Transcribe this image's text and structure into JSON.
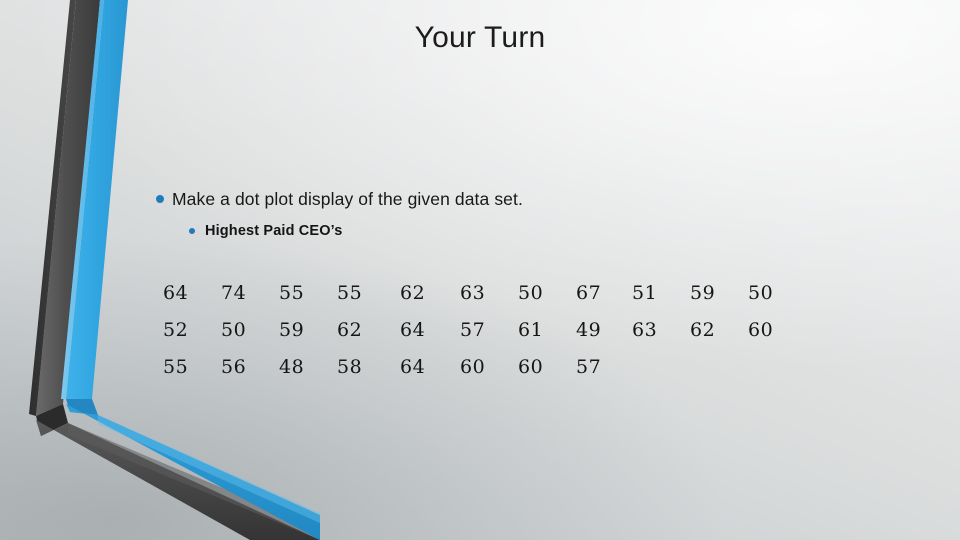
{
  "slide": {
    "title": "Your Turn",
    "accent_blue": "#35a8e0",
    "bullet_blue": "#1f7cb8",
    "band_gray": "#4d4d4d",
    "background_light": "#ecedee",
    "background_dark": "#c0c4c6"
  },
  "content": {
    "bullets": [
      {
        "level": 1,
        "text": "Make a dot plot display of the given data set."
      },
      {
        "level": 2,
        "text": "Highest Paid CEO’s"
      }
    ]
  },
  "chart_data": {
    "type": "table",
    "title": "Highest Paid CEO’s",
    "caption": "Make a dot plot display of the given data set.",
    "columns": 11,
    "rows": [
      [
        "64",
        "74",
        "55",
        "55",
        "62",
        "63",
        "50",
        "67",
        "51",
        "59",
        "50"
      ],
      [
        "52",
        "50",
        "59",
        "62",
        "64",
        "57",
        "61",
        "49",
        "63",
        "62",
        "60"
      ],
      [
        "55",
        "56",
        "48",
        "58",
        "64",
        "60",
        "60",
        "57",
        "",
        "",
        ""
      ]
    ],
    "values": [
      64,
      74,
      55,
      55,
      62,
      63,
      50,
      67,
      51,
      59,
      50,
      52,
      50,
      59,
      62,
      64,
      57,
      61,
      49,
      63,
      62,
      60,
      55,
      56,
      48,
      58,
      64,
      60,
      60,
      57
    ],
    "count": 30,
    "min": 48,
    "max": 74
  },
  "layout": {
    "column_x": [
      3,
      61,
      119,
      177,
      240,
      300,
      358,
      416,
      472,
      530,
      588
    ]
  }
}
